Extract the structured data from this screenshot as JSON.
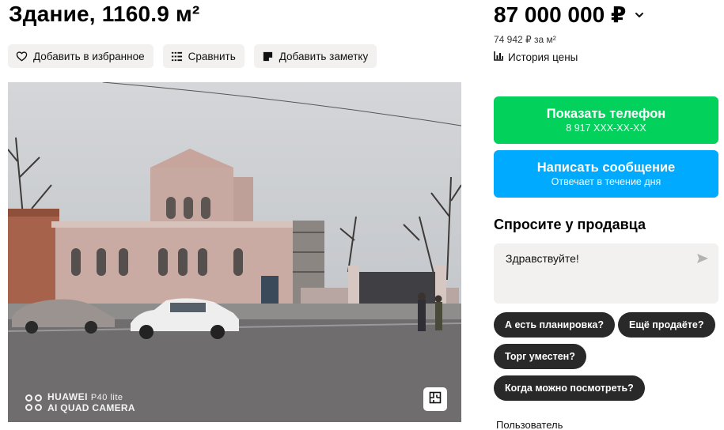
{
  "listing": {
    "title": "Здание, 1160.9 м²"
  },
  "actions": {
    "favorite_label": "Добавить в избранное",
    "compare_label": "Сравнить",
    "note_label": "Добавить заметку"
  },
  "photo": {
    "watermark_brand": "HUAWEI",
    "watermark_model": "P40 lite",
    "watermark_camera": "AI QUAD CAMERA"
  },
  "pricing": {
    "price": "87 000 000 ₽",
    "per_meter": "74 942 ₽ за м²",
    "history_label": "История цены"
  },
  "contact": {
    "phone_button_label": "Показать телефон",
    "phone_masked": "8 917 XXX-XX-XX",
    "message_button_label": "Написать сообщение",
    "message_subtext": "Отвечает в течение дня"
  },
  "ask": {
    "title": "Спросите у продавца",
    "input_value": "Здравствуйте!",
    "quick_questions": [
      "А есть планировка?",
      "Ещё продаёте?",
      "Торг уместен?",
      "Когда можно посмотреть?"
    ]
  },
  "seller": {
    "type_label": "Пользователь"
  },
  "colors": {
    "phone_button": "#02d15c",
    "message_button": "#00aaff",
    "chip_background": "#292929",
    "gray_button": "#f2f1f0"
  },
  "icons": [
    "heart-icon",
    "compare-icon",
    "note-icon",
    "chevron-down-icon",
    "chart-icon",
    "send-icon",
    "floor-plan-icon"
  ]
}
